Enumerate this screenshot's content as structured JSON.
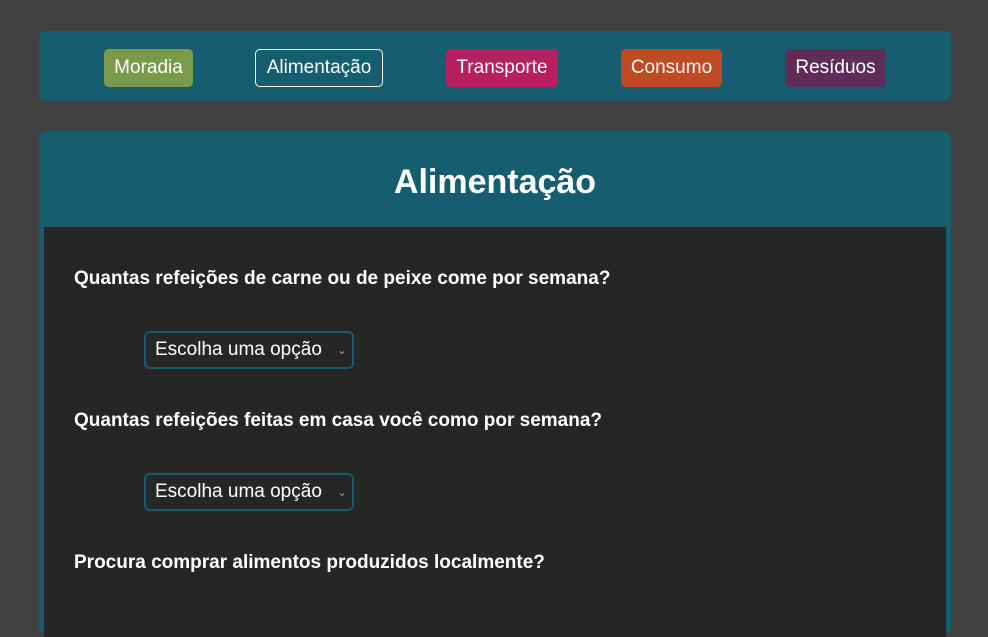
{
  "nav": {
    "tabs": [
      {
        "label": "Moradia",
        "color": "#7a9a4b"
      },
      {
        "label": "Alimentação",
        "active": true
      },
      {
        "label": "Transporte",
        "color": "#b6205e"
      },
      {
        "label": "Consumo",
        "color": "#c04a22"
      },
      {
        "label": "Resíduos",
        "color": "#5f2d59"
      }
    ]
  },
  "section": {
    "title": "Alimentação",
    "questions": [
      {
        "text": "Quantas refeições de carne ou de peixe come por semana?",
        "select_value": "Escolha uma opção"
      },
      {
        "text": "Quantas refeições feitas em casa você como por semana?",
        "select_value": "Escolha uma opção"
      },
      {
        "text": "Procura comprar alimentos produzidos localmente?"
      }
    ]
  },
  "colors": {
    "page_bg": "#414141",
    "accent": "#155d6f",
    "panel_bg": "#262626"
  }
}
